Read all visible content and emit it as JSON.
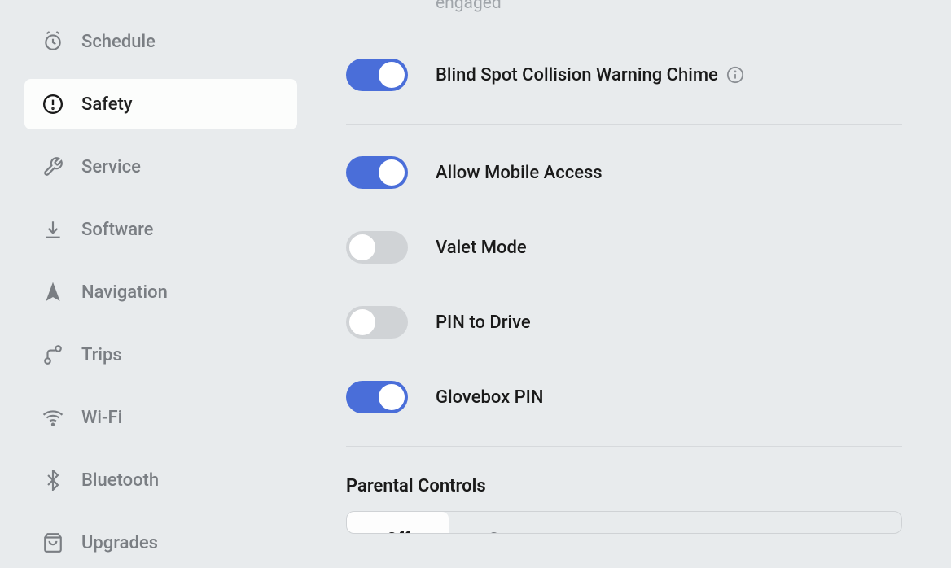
{
  "sidebar": {
    "items": [
      {
        "key": "schedule",
        "label": "Schedule"
      },
      {
        "key": "safety",
        "label": "Safety",
        "active": true
      },
      {
        "key": "service",
        "label": "Service"
      },
      {
        "key": "software",
        "label": "Software"
      },
      {
        "key": "navigation",
        "label": "Navigation"
      },
      {
        "key": "trips",
        "label": "Trips"
      },
      {
        "key": "wifi",
        "label": "Wi-Fi"
      },
      {
        "key": "bluetooth",
        "label": "Bluetooth"
      },
      {
        "key": "upgrades",
        "label": "Upgrades"
      }
    ]
  },
  "main": {
    "partial_top_text": "engaged",
    "settings_group_1": [
      {
        "key": "blind_spot",
        "label": "Blind Spot Collision Warning Chime",
        "on": true,
        "has_info": true
      }
    ],
    "settings_group_2": [
      {
        "key": "mobile_access",
        "label": "Allow Mobile Access",
        "on": true
      },
      {
        "key": "valet_mode",
        "label": "Valet Mode",
        "on": false
      },
      {
        "key": "pin_to_drive",
        "label": "PIN to Drive",
        "on": false
      },
      {
        "key": "glovebox_pin",
        "label": "Glovebox PIN",
        "on": true
      }
    ],
    "parental": {
      "title": "Parental Controls",
      "options": {
        "off": "Off",
        "on": "On"
      },
      "selected": "off"
    }
  }
}
